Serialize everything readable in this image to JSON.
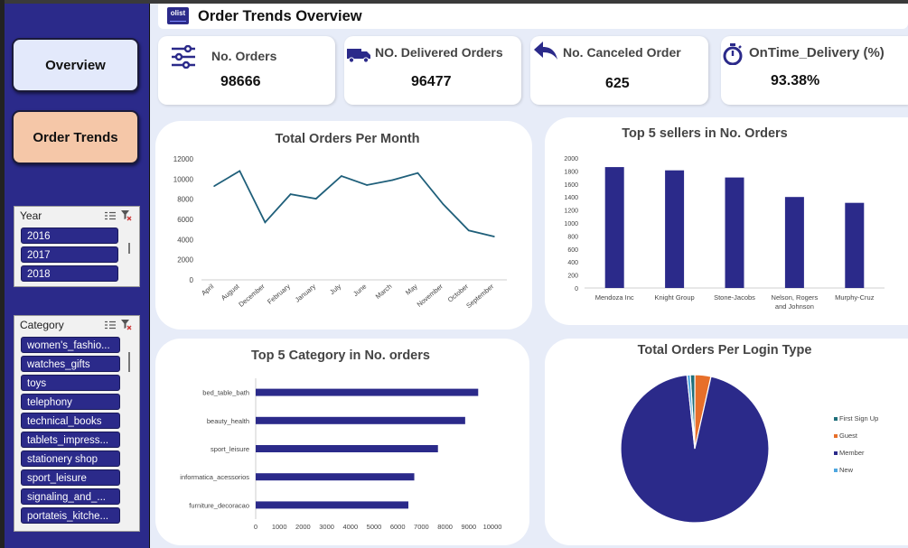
{
  "header": {
    "logo_text": "olist",
    "title": "Order Trends Overview"
  },
  "nav": {
    "overview_label": "Overview",
    "trends_label": "Order Trends"
  },
  "slicers": {
    "year": {
      "title": "Year",
      "items": [
        "2016",
        "2017",
        "2018"
      ]
    },
    "category": {
      "title": "Category",
      "items": [
        "women's_fashio...",
        "watches_gifts",
        "toys",
        "telephony",
        "technical_books",
        "tablets_impress...",
        "stationery shop",
        "sport_leisure",
        "signaling_and_...",
        "portateis_kitche..."
      ]
    }
  },
  "kpis": {
    "orders": {
      "label": "No. Orders",
      "value": "98666",
      "icon": "sliders-icon"
    },
    "delivered": {
      "label": "NO. Delivered Orders",
      "value": "96477",
      "icon": "truck-icon"
    },
    "canceled": {
      "label": "No. Canceled Order",
      "value": "625",
      "icon": "reply-arrow-icon"
    },
    "ontime": {
      "label": "OnTime_Delivery (%)",
      "value": "93.38%",
      "icon": "stopwatch-icon"
    }
  },
  "colors": {
    "accent": "#2b2a8a",
    "line": "#1f5f7a",
    "peach": "#f5c7a8",
    "orange": "#e76f2a",
    "teal": "#1f6f7a",
    "light_blue": "#4ea7e0"
  },
  "chart_data": [
    {
      "id": "orders-per-month",
      "type": "line",
      "title": "Total Orders Per Month",
      "categories": [
        "April",
        "August",
        "December",
        "February",
        "January",
        "July",
        "June",
        "March",
        "May",
        "November",
        "October",
        "September"
      ],
      "values": [
        9300,
        10800,
        5700,
        8500,
        8050,
        10300,
        9400,
        9900,
        10600,
        7500,
        4900,
        4300
      ],
      "ylim": [
        0,
        12000
      ],
      "yticks": [
        "0",
        "2000",
        "4000",
        "6000",
        "8000",
        "10000",
        "12000"
      ]
    },
    {
      "id": "top-sellers",
      "type": "bar",
      "title": "Top 5 sellers in No. Orders",
      "categories": [
        "Mendoza Inc",
        "Knight Group",
        "Stone-Jacobs",
        "Nelson, Rogers and Johnson",
        "Murphy-Cruz"
      ],
      "values": [
        1860,
        1810,
        1700,
        1400,
        1310
      ],
      "ylim": [
        0,
        2000
      ],
      "yticks": [
        "0",
        "200",
        "400",
        "600",
        "800",
        "1000",
        "1200",
        "1400",
        "1600",
        "1800",
        "2000"
      ]
    },
    {
      "id": "top-categories",
      "type": "bar",
      "orientation": "horizontal",
      "title": "Top 5 Category in No. orders",
      "categories": [
        "bed_table_bath",
        "beauty_health",
        "sport_leisure",
        "informatica_acessorios",
        "furniture_decoracao"
      ],
      "values": [
        9400,
        8850,
        7700,
        6700,
        6450
      ],
      "xlim": [
        0,
        10000
      ],
      "xticks": [
        "0",
        "1000",
        "2000",
        "3000",
        "4000",
        "5000",
        "6000",
        "7000",
        "8000",
        "9000",
        "10000"
      ]
    },
    {
      "id": "login-type",
      "type": "pie",
      "title": "Total Orders Per Login Type",
      "labels": [
        "First Sign Up",
        "Guest",
        "Member",
        "New"
      ],
      "values": [
        1,
        3.5,
        94.8,
        0.7
      ],
      "colors": [
        "#1f6f7a",
        "#e76f2a",
        "#2b2a8a",
        "#4ea7e0"
      ],
      "legend": "right"
    }
  ]
}
